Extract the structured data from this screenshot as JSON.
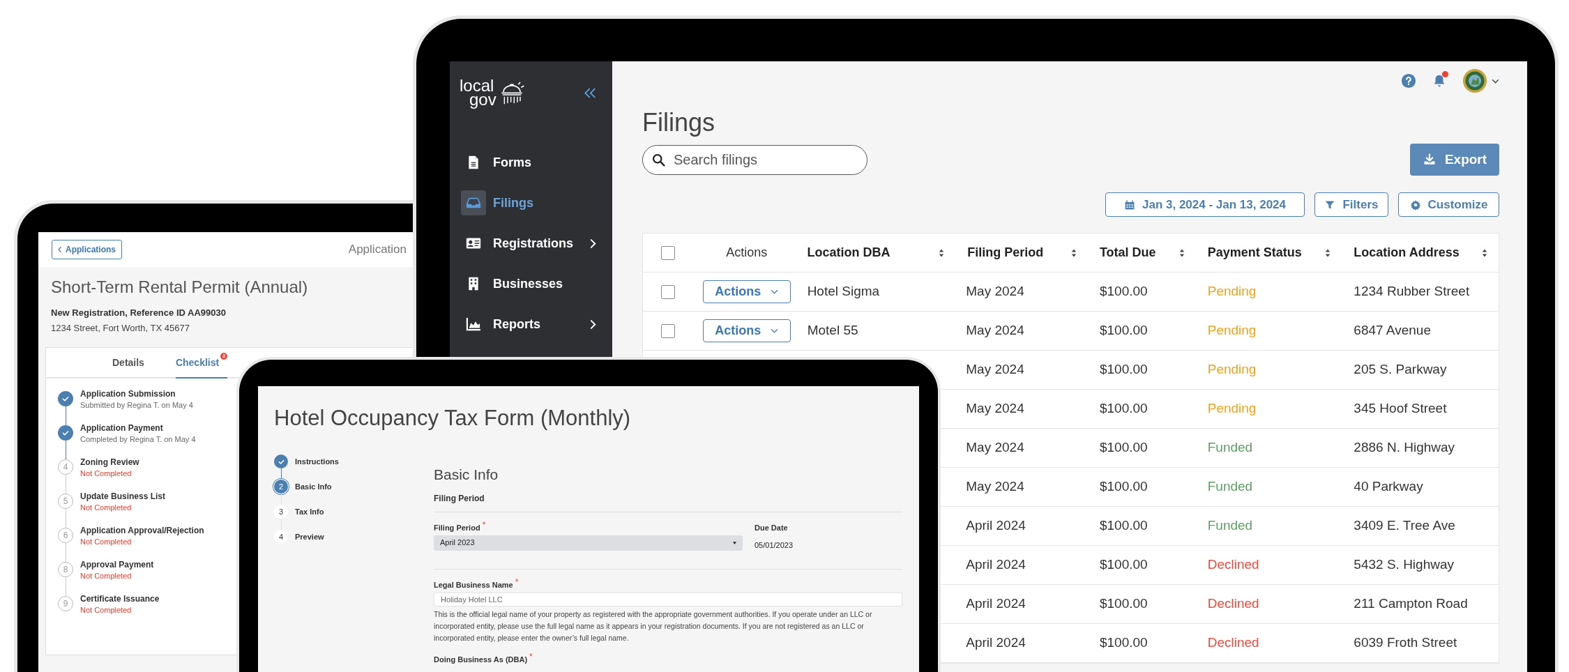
{
  "permit_tablet": {
    "back_button": "Applications",
    "header_title": "Application",
    "title": "Short-Term Rental Permit (Annual)",
    "reference": "New Registration, Reference ID AA99030",
    "address": "1234 Street, Fort Worth, TX 45677",
    "tabs": [
      {
        "label": "Details",
        "selected": false
      },
      {
        "label": "Checklist",
        "selected": true,
        "badge": "2"
      }
    ],
    "checklist": [
      {
        "title": "Application Submission",
        "subtitle": "Submitted by Regina T. on May 4",
        "done": true
      },
      {
        "title": "Application Payment",
        "subtitle": "Completed by Regina T. on May 4",
        "done": true
      },
      {
        "title": "Zoning Review",
        "subtitle": "Not Completed",
        "done": false,
        "number": "4"
      },
      {
        "title": "Update Business List",
        "subtitle": "Not Completed",
        "done": false,
        "number": "5"
      },
      {
        "title": "Application Approval/Rejection",
        "subtitle": "Not Completed",
        "done": false,
        "number": "6"
      },
      {
        "title": "Approval Payment",
        "subtitle": "Not Completed",
        "done": false,
        "number": "8"
      },
      {
        "title": "Certificate Issuance",
        "subtitle": "Not Completed",
        "done": false,
        "number": "9"
      }
    ]
  },
  "filings_tablet": {
    "logo": [
      "local",
      "gov"
    ],
    "sidebar": {
      "items": [
        {
          "label": "Forms",
          "selected": false,
          "expandable": false
        },
        {
          "label": "Filings",
          "selected": true,
          "expandable": false
        },
        {
          "label": "Registrations",
          "selected": false,
          "expandable": true
        },
        {
          "label": "Businesses",
          "selected": false,
          "expandable": false
        },
        {
          "label": "Reports",
          "selected": false,
          "expandable": true
        }
      ]
    },
    "notifications_unread": true,
    "title": "Filings",
    "search": {
      "placeholder": "Search filings"
    },
    "export_button": "Export",
    "date_range": "Jan 3, 2024 - Jan 13, 2024",
    "filters_button": "Filters",
    "customize_button": "Customize",
    "table": {
      "select_all_checked": false,
      "columns": [
        {
          "label": "Actions",
          "sortable": false
        },
        {
          "label": "Location DBA",
          "sortable": true
        },
        {
          "label": "Filing Period",
          "sortable": true
        },
        {
          "label": "Total Due",
          "sortable": true
        },
        {
          "label": "Payment Status",
          "sortable": true
        },
        {
          "label": "Location Address",
          "sortable": true
        }
      ],
      "rows": [
        {
          "checked": false,
          "action": "Actions",
          "dba": "Hotel Sigma",
          "period": "May 2024",
          "total": "$100.00",
          "status": "Pending",
          "color": "#f0a21c",
          "address": "1234 Rubber Street"
        },
        {
          "checked": false,
          "action": "Actions",
          "dba": "Motel 55",
          "period": "May 2024",
          "total": "$100.00",
          "status": "Pending",
          "color": "#f0a21c",
          "address": "6847 Avenue"
        },
        {
          "period": "May 2024",
          "total": "$100.00",
          "status": "Pending",
          "color": "#f0a21c",
          "address": "205 S. Parkway"
        },
        {
          "period": "May 2024",
          "total": "$100.00",
          "status": "Pending",
          "color": "#f0a21c",
          "address": "345 Hoof Street"
        },
        {
          "period": "May 2024",
          "total": "$100.00",
          "status": "Funded",
          "color": "#5f9f62",
          "address": "2886 N. Highway"
        },
        {
          "period": "May 2024",
          "total": "$100.00",
          "status": "Funded",
          "color": "#5f9f62",
          "address": "40 Parkway"
        },
        {
          "period": "April 2024",
          "total": "$100.00",
          "status": "Funded",
          "color": "#5f9f62",
          "address": "3409 E. Tree Ave"
        },
        {
          "period": "April 2024",
          "total": "$100.00",
          "status": "Declined",
          "color": "#ef4a3c",
          "address": "5432 S. Highway"
        },
        {
          "period": "April 2024",
          "total": "$100.00",
          "status": "Declined",
          "color": "#ef4a3c",
          "address": "211 Campton Road"
        },
        {
          "period": "April 2024",
          "total": "$100.00",
          "status": "Declined",
          "color": "#ef4a3c",
          "address": "6039 Froth Street"
        }
      ]
    }
  },
  "tax_form_tablet": {
    "title": "Hotel Occupancy Tax Form (Monthly)",
    "steps": [
      {
        "label": "Instructions",
        "done": true,
        "selected": false
      },
      {
        "label": "Basic Info",
        "number": "2",
        "done": false,
        "selected": true
      },
      {
        "label": "Tax Info",
        "number": "3",
        "done": false,
        "selected": false
      },
      {
        "label": "Preview",
        "number": "4",
        "done": false,
        "selected": false
      }
    ],
    "section_title": "Basic Info",
    "subsection": "Filing Period",
    "filing_period": {
      "label": "Filing Period",
      "required_mark": "*",
      "value": "April 2023"
    },
    "due_date": {
      "label": "Due Date",
      "value": "05/01/2023"
    },
    "legal_name": {
      "label": "Legal Business Name",
      "required_mark": "*",
      "value": "Holiday Hotel LLC",
      "help": "This is the official legal name of your property as registered with the appropriate government authorities. If you operate under an LLC or incorporated entity, please use the full legal name as it appears in your registration documents. If you are not registered as an LLC or incorporated entity, please enter the owner’s full legal name."
    },
    "dba_label": {
      "label": "Doing Business As (DBA)",
      "required_mark": "*"
    }
  }
}
